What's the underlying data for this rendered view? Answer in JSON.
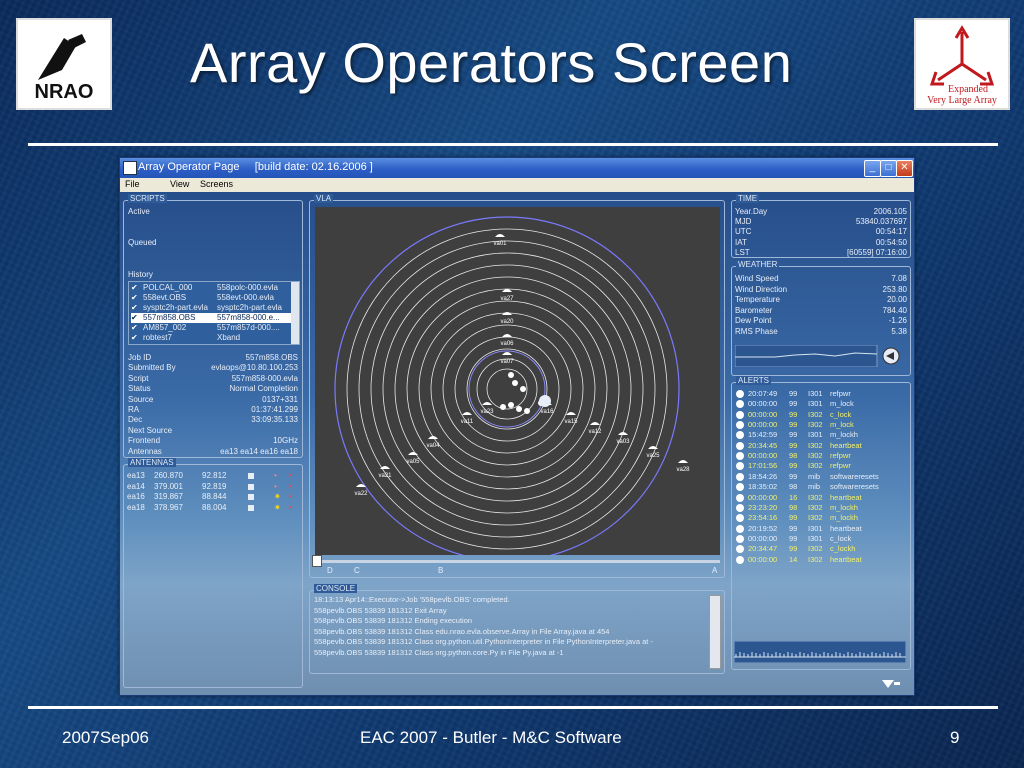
{
  "slide": {
    "title": "Array Operators Screen",
    "footer_left": "2007Sep06",
    "footer_center": "EAC 2007 - Butler - M&C Software",
    "footer_right": "9",
    "nrao_logo_text": "NRAO",
    "evla_logo_line1": "Expanded",
    "evla_logo_line2": "Very Large Array"
  },
  "window": {
    "title": "Array Operator Page",
    "build": "[build date: 02.16.2006 ]",
    "menu": [
      "File",
      "View",
      "Screens"
    ]
  },
  "scripts": {
    "label": "SCRIPTS",
    "active_label": "Active",
    "queued_label": "Queued",
    "history_label": "History",
    "history": [
      {
        "name": "POLCAL_000",
        "file": "558polc-000.evla"
      },
      {
        "name": "558evt.OBS",
        "file": "558evt-000.evla"
      },
      {
        "name": "sysptc2h-part.evla",
        "file": "sysptc2h-part.evla"
      },
      {
        "name": "557m858.OBS",
        "file": "557m858-000.e..."
      },
      {
        "name": "AM857_002",
        "file": "557m857d-000...."
      },
      {
        "name": "robtest7",
        "file": "Xband"
      }
    ],
    "job": [
      {
        "k": "Job ID",
        "v": "557m858.OBS"
      },
      {
        "k": "Submitted By",
        "v": "evlaops@10.80.100.253"
      },
      {
        "k": "Script",
        "v": "557m858-000.evla"
      },
      {
        "k": "Status",
        "v": "Normal Completion"
      },
      {
        "k": "Source",
        "v": "0137+331"
      },
      {
        "k": "RA",
        "v": "01:37:41.299"
      },
      {
        "k": "Dec",
        "v": "33:09:35.133"
      },
      {
        "k": "Next Source",
        "v": ""
      },
      {
        "k": "Frontend",
        "v": "10GHz"
      },
      {
        "k": "Antennas",
        "v": "ea13 ea14 ea16 ea18"
      }
    ]
  },
  "antennas": {
    "label": "ANTENNAS",
    "rows": [
      {
        "name": "ea13",
        "az": "260.870",
        "el": "92.812"
      },
      {
        "name": "ea14",
        "az": "379.001",
        "el": "92.819"
      },
      {
        "name": "ea16",
        "az": "319.867",
        "el": "88.844"
      },
      {
        "name": "ea18",
        "az": "378.967",
        "el": "88.004"
      }
    ]
  },
  "vla": {
    "label": "VLA",
    "antenna_labels": [
      "va01",
      "va27",
      "va20",
      "va06",
      "va07",
      "va23",
      "va11",
      "va15",
      "va16",
      "va12",
      "va04",
      "va05",
      "va03",
      "va25",
      "va21",
      "va28",
      "va22"
    ],
    "scale": [
      "D",
      "C",
      "B",
      "A"
    ]
  },
  "console": {
    "label": "CONSOLE",
    "lines": [
      "18:13:13 Apr14::Executor->Job '558pevlb.OBS' completed.",
      "558pevlb.OBS 53839 181312 Exit Array",
      "558pevlb.OBS 53839 181312 Ending execution",
      "558pevlb.OBS 53839 181312 Class edu.nrao.evla.observe.Array in File Array.java at 454",
      "558pevlb.OBS 53839 181312 Class org.python.util.PythonInterpreter in File PythonInterpreter.java at -",
      "558pevlb.OBS 53839 181312 Class org.python.core.Py in File Py.java at -1"
    ]
  },
  "time": {
    "label": "TIME",
    "rows": [
      {
        "k": "Year.Day",
        "v": "2006.105"
      },
      {
        "k": "MJD",
        "v": "53840.037697"
      },
      {
        "k": "UTC",
        "v": "00:54:17"
      },
      {
        "k": "IAT",
        "v": "00:54:50"
      },
      {
        "k": "LST",
        "v": "[60559] 07:16:00"
      }
    ]
  },
  "weather": {
    "label": "WEATHER",
    "rows": [
      {
        "k": "Wind Speed",
        "v": "7.08"
      },
      {
        "k": "Wind Direction",
        "v": "253.80"
      },
      {
        "k": "Temperature",
        "v": "20.00"
      },
      {
        "k": "Barometer",
        "v": "784.40"
      },
      {
        "k": "Dew Point",
        "v": "-1.26"
      },
      {
        "k": "RMS Phase",
        "v": "5.38"
      }
    ]
  },
  "alerts": {
    "label": "ALERTS",
    "rows": [
      {
        "t": "20:07:49",
        "c": "99",
        "d": "I301",
        "m": "refpwr",
        "color": "#e8eef8"
      },
      {
        "t": "00:00:00",
        "c": "99",
        "d": "I301",
        "m": "m_lock",
        "color": "#e8eef8"
      },
      {
        "t": "00:00:00",
        "c": "99",
        "d": "I302",
        "m": "c_lock",
        "color": "#f4f06a"
      },
      {
        "t": "00:00:00",
        "c": "99",
        "d": "I302",
        "m": "m_lock",
        "color": "#f4f06a"
      },
      {
        "t": "15:42:59",
        "c": "99",
        "d": "I301",
        "m": "m_lockh",
        "color": "#e8eef8"
      },
      {
        "t": "20:34:45",
        "c": "99",
        "d": "I302",
        "m": "heartbeat",
        "color": "#f4f06a"
      },
      {
        "t": "00:00:00",
        "c": "98",
        "d": "I302",
        "m": "refpwr",
        "color": "#f4f06a"
      },
      {
        "t": "17:01:56",
        "c": "99",
        "d": "I302",
        "m": "refpwr",
        "color": "#f4f06a"
      },
      {
        "t": "18:54:26",
        "c": "99",
        "d": "mib",
        "m": "softwareresets",
        "color": "#e8eef8"
      },
      {
        "t": "18:35:02",
        "c": "98",
        "d": "mib",
        "m": "softwareresets",
        "color": "#e8eef8"
      },
      {
        "t": "00:00:00",
        "c": "16",
        "d": "I302",
        "m": "heartbeat",
        "color": "#f4f06a"
      },
      {
        "t": "23:23:20",
        "c": "98",
        "d": "I302",
        "m": "m_lockh",
        "color": "#f4f06a"
      },
      {
        "t": "23:54:16",
        "c": "99",
        "d": "I302",
        "m": "m_lockh",
        "color": "#f4f06a"
      },
      {
        "t": "20:19:52",
        "c": "99",
        "d": "I301",
        "m": "heartbeat",
        "color": "#e8eef8"
      },
      {
        "t": "00:00:00",
        "c": "99",
        "d": "I301",
        "m": "c_lock",
        "color": "#e8eef8"
      },
      {
        "t": "20:34:47",
        "c": "99",
        "d": "I302",
        "m": "c_lockh",
        "color": "#f4f06a"
      },
      {
        "t": "00:00:00",
        "c": "14",
        "d": "I302",
        "m": "heartbeat",
        "color": "#f4f06a"
      }
    ]
  }
}
